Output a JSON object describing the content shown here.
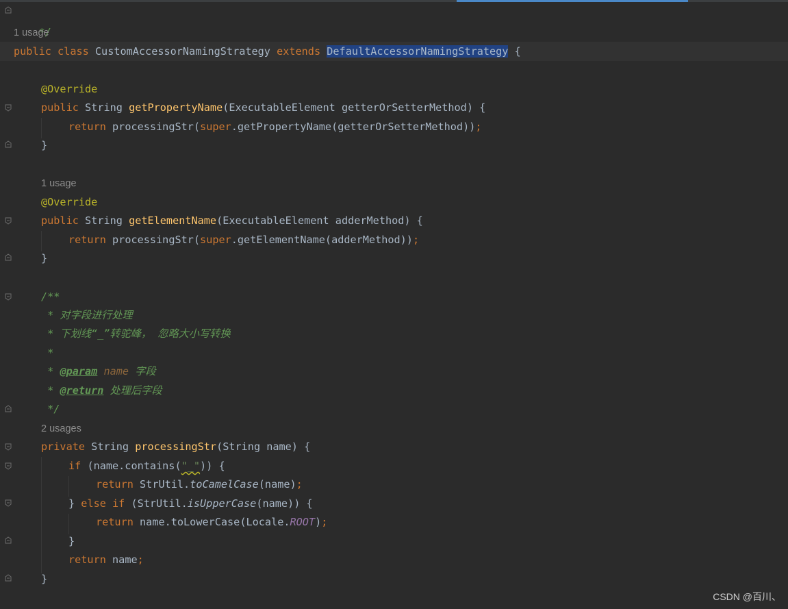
{
  "editor": {
    "lines": {
      "comment_end": "*/",
      "class_decl": {
        "public": "public",
        "class": "class",
        "name": "CustomAccessorNamingStrategy",
        "extends": "extends",
        "parent": "DefaultAccessorNamingStrategy",
        "brace": "{"
      },
      "m1": {
        "annotation": "@Override",
        "public": "public",
        "type": "String",
        "name": "getPropertyName",
        "params": "(ExecutableElement getterOrSetterMethod) {",
        "return_kw": "return",
        "body_a": "processingStr(",
        "super": "super",
        "body_b": ".getPropertyName(getterOrSetterMethod))",
        "semi": ";",
        "close": "}"
      },
      "m2": {
        "annotation": "@Override",
        "public": "public",
        "type": "String",
        "name": "getElementName",
        "params": "(ExecutableElement adderMethod) {",
        "return_kw": "return",
        "body_a": "processingStr(",
        "super": "super",
        "body_b": ".getElementName(adderMethod))",
        "semi": ";",
        "close": "}"
      },
      "javadoc": {
        "open": "/**",
        "l1": " * 对字段进行处理",
        "l2": " * 下划线“_”转驼峰， 忽略大小写转换",
        "l3": " *",
        "star": " * ",
        "param_tag": "@param",
        "param_name": "name",
        "param_desc": " 字段",
        "return_tag": "@return",
        "return_desc": " 处理后字段",
        "close": " */"
      },
      "m3": {
        "private": "private",
        "type": "String",
        "name": "processingStr",
        "params": "(String name) {",
        "if_kw": "if",
        "cond_a": " (name.contains(",
        "cond_str": "\"_\"",
        "cond_b": ")) {",
        "return_kw": "return",
        "r1_a": "StrUtil.",
        "r1_m": "toCamelCase",
        "r1_b": "(name)",
        "semi": ";",
        "else_open": "} ",
        "else_kw": "else if",
        "cond2_a": " (StrUtil.",
        "cond2_m": "isUpperCase",
        "cond2_b": "(name)) {",
        "r2_a": "name.toLowerCase(Locale.",
        "r2_c": "ROOT",
        "r2_b": ")",
        "close_if": "}",
        "r3": "name",
        "close": "}"
      }
    },
    "hints": {
      "class_usage": "1 usage",
      "m2_usage": "1 usage",
      "m3_usage": "2 usages"
    }
  },
  "watermark": "CSDN @百川、",
  "colors": {
    "background": "#2b2b2b",
    "keyword": "#cc7832",
    "method": "#ffc66d",
    "annotation": "#bbb529",
    "doc_comment": "#629755",
    "string": "#6a8759",
    "constant": "#9876aa",
    "selection": "#214283"
  }
}
